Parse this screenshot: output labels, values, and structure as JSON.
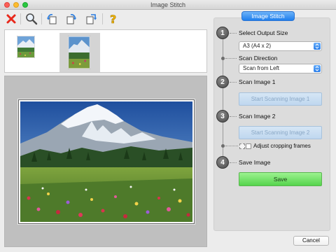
{
  "window": {
    "title": "Image Stitch"
  },
  "toolbar": {
    "tools": [
      {
        "name": "delete",
        "icon": "red-x-icon"
      },
      {
        "name": "zoom",
        "icon": "magnifier-icon"
      },
      {
        "name": "rotate-left",
        "icon": "rotate-left-icon"
      },
      {
        "name": "rotate-right",
        "icon": "rotate-right-icon"
      },
      {
        "name": "flip",
        "icon": "flip-icon"
      },
      {
        "name": "help",
        "icon": "question-icon"
      }
    ]
  },
  "panel": {
    "tab_label": "Image Stitch",
    "steps": [
      {
        "number": "1",
        "label": "Select Output Size"
      },
      {
        "number": "2",
        "label": "Scan Image 1"
      },
      {
        "number": "3",
        "label": "Scan Image 2"
      },
      {
        "number": "4",
        "label": "Save Image"
      }
    ],
    "output_size": {
      "selected": "A3 (A4 x 2)"
    },
    "scan_direction": {
      "label": "Scan Direction",
      "selected": "Scan from Left"
    },
    "scan1_button": "Start Scanning Image 1",
    "scan2_button": "Start Scanning Image 2",
    "adjust_cropping": {
      "label": "Adjust cropping frames",
      "checked": false
    },
    "save_button": "Save"
  },
  "footer": {
    "cancel_button": "Cancel"
  },
  "colors": {
    "accent_blue": "#1f7fee",
    "save_green": "#55d44c",
    "delete_red": "#e8291c"
  }
}
